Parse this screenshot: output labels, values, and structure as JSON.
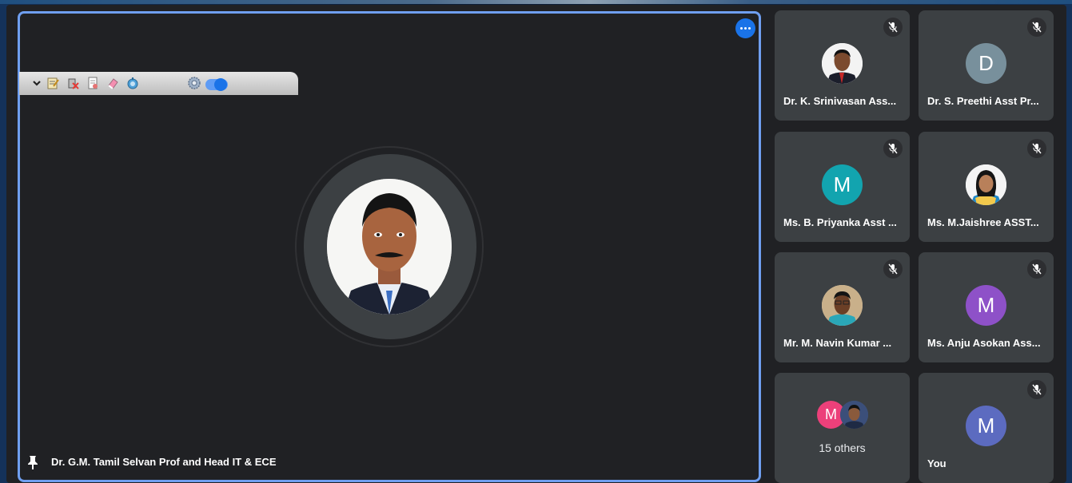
{
  "main": {
    "presenter_name": "Dr. G.M. Tamil Selvan Prof and Head IT & ECE",
    "more_options_icon": "more-horizontal-icon",
    "pinned_icon": "pin-icon",
    "accent_color": "#1a73e8",
    "border_color": "#6f9ff0"
  },
  "toolbar": {
    "icons": [
      "chevron-down-icon",
      "edit-notes-icon",
      "delete-icon",
      "document-icon",
      "eraser-icon",
      "timer-icon",
      "settings-icon",
      "toggle-switch"
    ],
    "toggle_on": true
  },
  "participants": [
    {
      "name": "Dr. K. Srinivasan Ass...",
      "avatar_type": "photo",
      "muted": true
    },
    {
      "name": "Dr. S. Preethi Asst Pr...",
      "avatar_type": "initial",
      "initial": "D",
      "color": "#78909c",
      "muted": true
    },
    {
      "name": "Ms. B. Priyanka Asst ...",
      "avatar_type": "initial",
      "initial": "M",
      "color": "#12a4af",
      "muted": true
    },
    {
      "name": "Ms. M.Jaishree ASST...",
      "avatar_type": "photo",
      "muted": true
    },
    {
      "name": "Mr. M. Navin Kumar ...",
      "avatar_type": "photo",
      "muted": true
    },
    {
      "name": "Ms. Anju Asokan Ass...",
      "avatar_type": "initial",
      "initial": "M",
      "color": "#8e51c8",
      "muted": true
    },
    {
      "others_label": "15 others",
      "initial": "M",
      "color": "#ec407a"
    },
    {
      "name": "You",
      "avatar_type": "initial",
      "initial": "M",
      "color": "#5c6bc0",
      "muted": true
    }
  ]
}
